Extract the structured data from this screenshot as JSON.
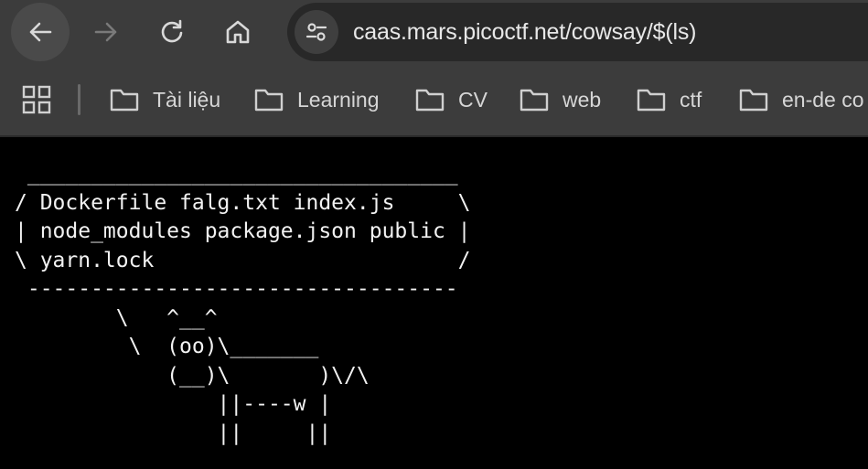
{
  "toolbar": {
    "url": "caas.mars.picoctf.net/cowsay/$(ls)",
    "back_icon": "arrow-left-icon",
    "forward_icon": "arrow-right-icon",
    "reload_icon": "reload-icon",
    "home_icon": "home-icon",
    "site_info_icon": "tune-icon"
  },
  "bookmarks": {
    "apps_icon": "apps-grid-icon",
    "items": [
      {
        "label": "Tài liệu",
        "icon": "folder-icon"
      },
      {
        "label": "Learning",
        "icon": "folder-icon"
      },
      {
        "label": "CV",
        "icon": "folder-icon"
      },
      {
        "label": "web",
        "icon": "folder-icon"
      },
      {
        "label": "ctf",
        "icon": "folder-icon"
      },
      {
        "label": "en-de co",
        "icon": "folder-icon"
      }
    ]
  },
  "page": {
    "cowsay_output": " __________________________________\n/ Dockerfile falg.txt index.js     \\\n| node_modules package.json public |\n\\ yarn.lock                        /\n ----------------------------------\n        \\   ^__^\n         \\  (oo)\\_______\n            (__)\\       )\\/\\\n                ||----w |\n                ||     ||"
  },
  "colors": {
    "chrome_bg": "#3c3c3c",
    "omnibox_bg": "#282828",
    "page_bg": "#000000",
    "text": "#f2f2f2"
  }
}
